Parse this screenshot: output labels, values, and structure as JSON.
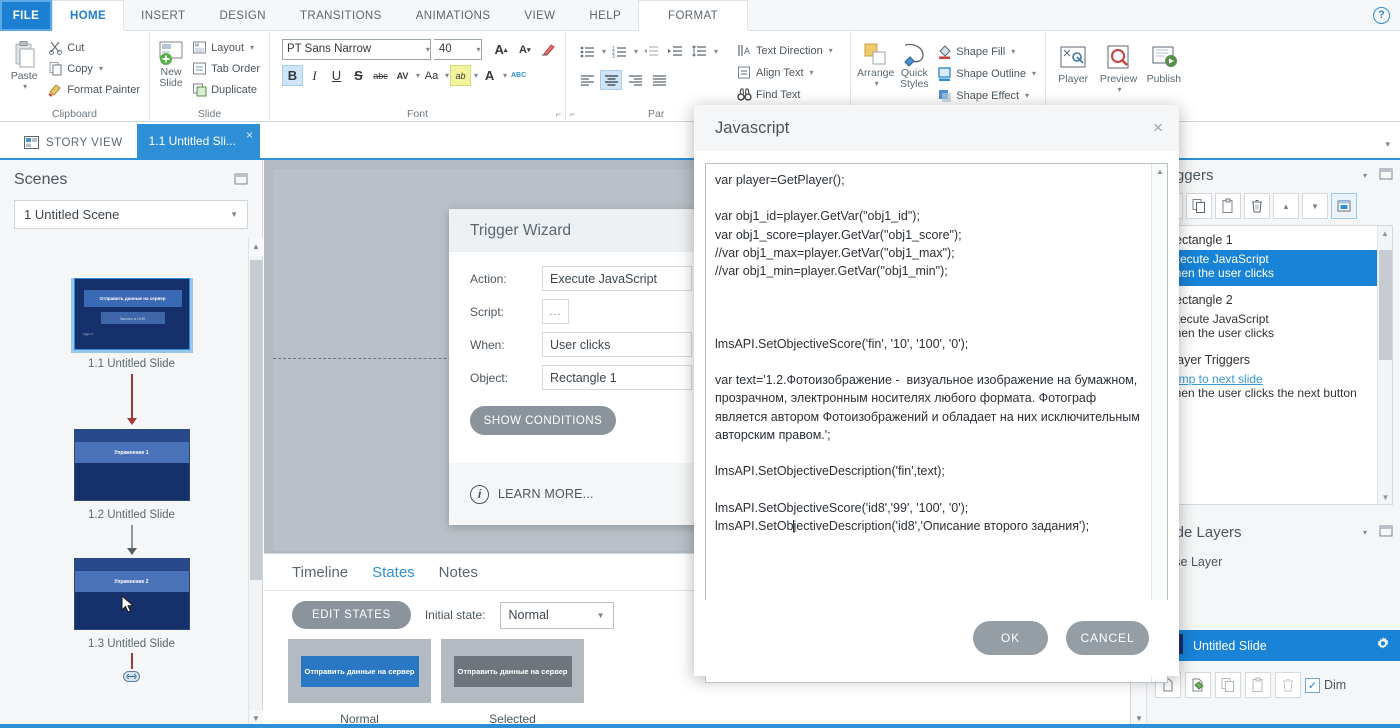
{
  "ribbon": {
    "tabs": [
      {
        "label": "FILE",
        "kind": "file"
      },
      {
        "label": "HOME",
        "kind": "active"
      },
      {
        "label": "INSERT",
        "kind": "normal"
      },
      {
        "label": "DESIGN",
        "kind": "normal"
      },
      {
        "label": "TRANSITIONS",
        "kind": "normal"
      },
      {
        "label": "ANIMATIONS",
        "kind": "normal"
      },
      {
        "label": "VIEW",
        "kind": "normal"
      },
      {
        "label": "HELP",
        "kind": "normal"
      },
      {
        "label": "FORMAT",
        "kind": "format"
      }
    ],
    "help_icon": "?",
    "clipboard": {
      "group_label": "Clipboard",
      "paste": "Paste",
      "cut": "Cut",
      "copy": "Copy",
      "format_painter": "Format Painter"
    },
    "slide": {
      "group_label": "Slide",
      "new_slide_line1": "New",
      "new_slide_line2": "Slide",
      "layout": "Layout",
      "tab_order": "Tab Order",
      "duplicate": "Duplicate"
    },
    "font": {
      "group_label": "Font",
      "font_name": "PT Sans Narrow",
      "font_size": "40",
      "bold": "B",
      "italic": "I",
      "underline": "U",
      "strikethrough": "S",
      "abc": "abc",
      "char_spacing": "AV",
      "change_case": "Aa",
      "text_highlight": "ab",
      "font_color": "A",
      "spelling": "ABC"
    },
    "paragraph": {
      "group_label": "Par",
      "text_direction": "Text Direction",
      "align_text": "Align Text",
      "find_text": "Find Text"
    },
    "drawing": {
      "arrange": "Arrange",
      "quick_styles_line1": "Quick",
      "quick_styles_line2": "Styles",
      "shape_fill": "Shape Fill",
      "shape_outline": "Shape Outline",
      "shape_effect": "Shape Effect"
    },
    "publish": {
      "player": "Player",
      "preview": "Preview",
      "publish": "Publish"
    }
  },
  "viewbar": {
    "story_view": "STORY VIEW",
    "slide_tab": "1.1 Untitled Sli...",
    "close_glyph": "×"
  },
  "scenes": {
    "title": "Scenes",
    "scene_selected": "1 Untitled Scene",
    "slides": [
      {
        "caption": "1.1 Untitled Slide",
        "selected": true,
        "shapes": [
          {
            "text": "Отправить данные на сервер",
            "role": "primary-button"
          },
          {
            "text": "Запись в LMS",
            "role": "secondary-button"
          },
          {
            "text": "чудо-н",
            "role": "small-text"
          }
        ]
      },
      {
        "caption": "1.2 Untitled Slide",
        "selected": false,
        "shapes": [
          {
            "text": "Упражнение 1",
            "role": "band"
          }
        ]
      },
      {
        "caption": "1.3 Untitled Slide",
        "selected": false,
        "shapes": [
          {
            "text": "Упражнение 2",
            "role": "band"
          }
        ]
      }
    ]
  },
  "timeline": {
    "tabs": [
      {
        "label": "Timeline",
        "active": false
      },
      {
        "label": "States",
        "active": true
      },
      {
        "label": "Notes",
        "active": false
      }
    ],
    "edit_states_button": "EDIT STATES",
    "initial_state_label": "Initial state:",
    "initial_state_value": "Normal",
    "state_cards": [
      {
        "name": "Normal",
        "button_text": "Отправить данные на сервер",
        "button_color": "#2a77c4"
      },
      {
        "name": "Selected",
        "button_text": "Отправить данные на сервер",
        "button_color": "#6e757c"
      }
    ]
  },
  "triggers_panel": {
    "title": "Triggers",
    "toolbar_icons": [
      "new-trigger-icon",
      "copy-icon",
      "paste-icon",
      "delete-icon",
      "move-up-icon",
      "move-down-icon",
      "trigger-order-icon"
    ],
    "groups": [
      {
        "title": "Rectangle 1",
        "items": [
          {
            "line1": "Execute JavaScript",
            "line2": "when the user clicks",
            "selected": true,
            "link": false
          }
        ]
      },
      {
        "title": "Rectangle 2",
        "items": [
          {
            "line1": "Execute JavaScript",
            "line2": "when the user clicks",
            "selected": false,
            "link": false
          }
        ]
      },
      {
        "title": "Player Triggers",
        "items": [
          {
            "line1": "Jump to next slide",
            "line2": "when the user clicks the next button",
            "selected": false,
            "link": true
          }
        ]
      }
    ]
  },
  "layers_panel": {
    "title": "Slide Layers",
    "base_layer_label": "Base Layer",
    "selected_layer": "Untitled Slide",
    "gear_icon": "gear-icon",
    "toolbar_icons": [
      "new-layer-icon",
      "duplicate-layer-icon",
      "copy-icon",
      "paste-icon",
      "delete-icon"
    ],
    "dim_checkbox_checked": true,
    "dim_label": "Dim"
  },
  "trigger_wizard": {
    "title": "Trigger Wizard",
    "action_label": "Action:",
    "action_value": "Execute JavaScript",
    "script_label": "Script:",
    "script_value": "...",
    "when_label": "When:",
    "when_value": "User clicks",
    "object_label": "Object:",
    "object_value": "Rectangle 1",
    "show_conditions": "SHOW CONDITIONS",
    "info_icon": "info-icon",
    "learn_more": "LEARN MORE..."
  },
  "javascript_dialog": {
    "title": "Javascript",
    "close_glyph": "×",
    "code_lines": [
      "var player=GetPlayer();",
      "",
      "var obj1_id=player.GetVar(\"obj1_id\");",
      "var obj1_score=player.GetVar(\"obj1_score\");",
      "//var obj1_max=player.GetVar(\"obj1_max\");",
      "//var obj1_min=player.GetVar(\"obj1_min\");",
      "",
      "",
      "",
      "lmsAPI.SetObjectiveScore('fin', '10', '100', '0');",
      "",
      "var text='1.2.Фотоизображение -  визуальное изображение на бумажном, прозрачном, электронным носителях любого формата. Фотограф является автором Фотоизображений и обладает на них исключительным авторским правом.';",
      "",
      "lmsAPI.SetObjectiveDescription('fin',text);",
      "",
      "lmsAPI.SetObjectiveScore('id8','99', '100', '0');",
      "lmsAPI.SetObjectiveDescription('id8','Описание второго задания');"
    ],
    "cursor_line_index": 16,
    "cursor_after_text": "lmsAPI.SetOb",
    "ok_button": "OK",
    "cancel_button": "CANCEL"
  },
  "colors": {
    "accent_blue": "#2e8fd6",
    "selection_blue": "#1883d7",
    "gray_button": "#8b949c",
    "canvas_gray": "#b3bac1",
    "panel_bg": "#f4f6f7"
  }
}
